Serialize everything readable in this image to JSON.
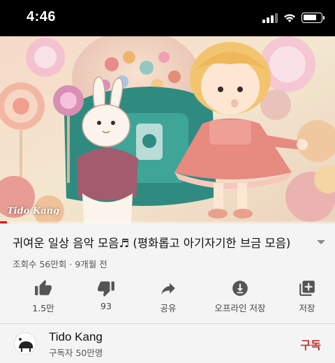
{
  "status_bar": {
    "time": "4:46",
    "icons": [
      "signal-icon",
      "wifi-icon",
      "battery-icon"
    ]
  },
  "video": {
    "watermark": "Tido Kang",
    "progress": 0.02
  },
  "title": "귀여운 일상 음악 모음♬ (평화롭고 아기자기한 브금 모음)",
  "meta": "조회수 56만회 · 9개월 전",
  "actions": [
    {
      "icon": "thumbs-up-icon",
      "label": "1.5만"
    },
    {
      "icon": "thumbs-down-icon",
      "label": "93"
    },
    {
      "icon": "share-icon",
      "label": "공유"
    },
    {
      "icon": "download-icon",
      "label": "오프라인 저장"
    },
    {
      "icon": "playlist-add-icon",
      "label": "저장"
    }
  ],
  "channel": {
    "name": "Tido Kang",
    "subscribers": "구독자 50만명",
    "subscribe_label": "구독"
  },
  "colors": {
    "accent": "#c4302b",
    "progress": "#ff0000",
    "icon": "#555555"
  }
}
